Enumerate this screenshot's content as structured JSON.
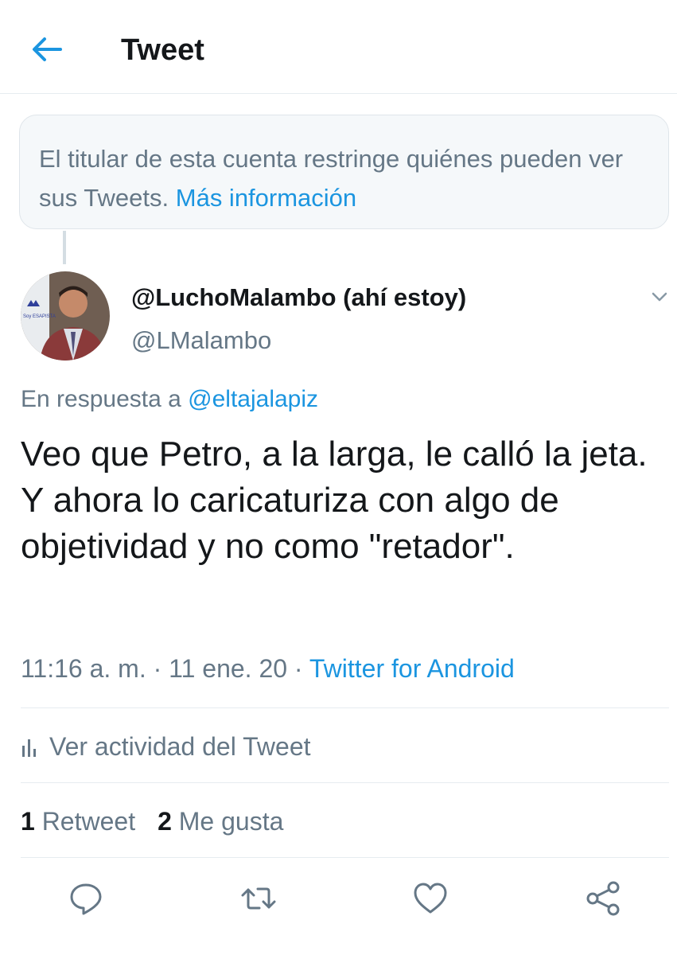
{
  "header": {
    "title": "Tweet",
    "back_icon": "arrow-left-icon"
  },
  "notice": {
    "text": "El titular de esta cuenta restringe quiénes pueden ver sus Tweets.",
    "link": "Más información"
  },
  "author": {
    "display_name": "@LuchoMalambo (ahí estoy)",
    "handle": "@LMalambo",
    "avatar_text": "Soy ESAPISTA"
  },
  "tweet": {
    "reply_prefix": "En respuesta a",
    "reply_to": "@eltajalapiz",
    "line1": "Veo que Petro, a la larga, le calló la jeta.",
    "line2": "Y ahora lo caricaturiza con algo de objetividad y no como \"retador\"."
  },
  "meta": {
    "time": "11:16 a. m.",
    "date": "11 ene. 20",
    "source": "Twitter for Android",
    "separator": "·"
  },
  "activity": {
    "label": "Ver actividad del Tweet"
  },
  "stats": {
    "retweets_count": "1",
    "retweets_label": "Retweet",
    "likes_count": "2",
    "likes_label": "Me gusta"
  },
  "actions": [
    "reply-icon",
    "retweet-icon",
    "like-icon",
    "share-icon"
  ],
  "colors": {
    "accent": "#1b95e0",
    "muted": "#657786",
    "text": "#14171a",
    "divider": "#e6ecf0"
  }
}
